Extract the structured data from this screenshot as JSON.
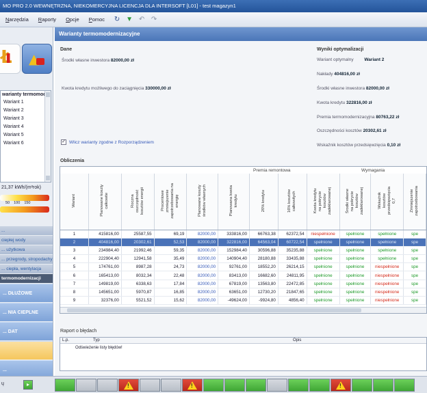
{
  "window": {
    "title": "MO PRO 2.0 WEWNĘTRZNA, NIEKOMERCYJNA LICENCJA DLA INTERSOFT [L01] - test magazyn1"
  },
  "menu": [
    {
      "label": "Narzędzia"
    },
    {
      "label": "Raporty"
    },
    {
      "label": "Opcje"
    },
    {
      "label": "Pomoc"
    }
  ],
  "panel": {
    "title": "Warianty termomodernizacyjne"
  },
  "sidebar": {
    "list_header": "warianty termomode",
    "list_items": [
      "Wariant 1",
      "Wariant 2",
      "Wariant 3",
      "Wariant 4",
      "Wariant 5",
      "Wariant 6"
    ],
    "rate": "21,37 kWh/(m²rok)",
    "scale_ticks": [
      "50",
      "100",
      "150"
    ],
    "small_items": [
      "... ",
      "ciepłej wody",
      "... użytkowa",
      "... przegrody, stropodachy",
      "... ciepła, wentylacja"
    ],
    "active_item": "termomodernizacji",
    "big_items": [
      "... DŁUŻOWE",
      "... NIA CIEPLNE",
      "... DAT",
      "",
      "... ",
      ""
    ]
  },
  "dane": {
    "label": "Dane",
    "own_funds_label": "Środki własne inwestora",
    "own_funds_value": "82000,00 zł",
    "credit_label": "Kwota kredytu możliwego do zaciągnięcia",
    "credit_value": "330000,00 zł",
    "checkbox_label": "Wlicz warianty zgodne z Rozporządzeniem"
  },
  "wyniki": {
    "label": "Wyniki optymalizacji",
    "optimal_label": "Wariant optymalny",
    "optimal_value": "Wariant 2",
    "expenses_label": "Nakłady",
    "expenses_value": "404816,00 zł",
    "own_label": "Środki własne inwestora",
    "own_value": "82000,00 zł",
    "credit_label": "Kwota kredytu",
    "credit_value": "322816,00 zł",
    "premium_label": "Premia termomodernizacyjna",
    "premium_value": "80763,22 zł",
    "savings_label": "Oszczędności kosztów",
    "savings_value": "20302,61 zł",
    "ratio_label": "Wskaźnik kosztów przedsięwzięcia",
    "ratio_value": "0,10 zł"
  },
  "obliczenia": {
    "label": "Obliczenia",
    "group_premia": "Premia remontowa",
    "group_wymagania": "Wymagania",
    "columns": [
      "Wariant",
      "Planowane koszty\ncałkowite",
      "Roczna\noszczędność\nkosztów energii",
      "Procentowe\nzmniejszenie\nzapotrzebowania na\nenergię",
      "Planowane koszty\nśrodków własnych",
      "Planowana kwota\nkredytu",
      "20% kredytu",
      "16% kosztów\ncałkowitych",
      "Kwota kredytu\nna pokrycie\nkosztów\nzadeklarowanej",
      "Środki własne\nna pokrycie\nkosztów\nzadeklarowanej",
      "Wskaźnik\nkosztów\nprzedsięwzięcia\n0,7",
      "Zmniejszenie\nzapotrzebowania"
    ],
    "rows": [
      [
        "1",
        "415816,00",
        "25587,55",
        "69,19",
        "82000,00",
        "333816,00",
        "66763,38",
        "62372,54",
        "niespełnione",
        "spełnione",
        "spełnione",
        "spe"
      ],
      [
        "2",
        "404816,00",
        "20302,61",
        "52,53",
        "82000,00",
        "322816,00",
        "64563,04",
        "60722,54",
        "spełnione",
        "spełnione",
        "spełnione",
        "spe"
      ],
      [
        "3",
        "234984,40",
        "21992,46",
        "59,35",
        "82000,00",
        "152984,40",
        "30596,88",
        "35235,88",
        "spełnione",
        "spełnione",
        "spełnione",
        "spe"
      ],
      [
        "4",
        "222904,40",
        "12941,58",
        "35,49",
        "82000,00",
        "140904,40",
        "28180,88",
        "33435,88",
        "spełnione",
        "spełnione",
        "spełnione",
        "spe"
      ],
      [
        "5",
        "174761,00",
        "8987,28",
        "24,73",
        "82000,00",
        "92761,00",
        "18552,20",
        "26214,15",
        "spełnione",
        "spełnione",
        "niespełnione",
        "spe"
      ],
      [
        "6",
        "165413,00",
        "8032,34",
        "22,48",
        "82000,00",
        "83413,00",
        "16682,60",
        "24811,95",
        "spełnione",
        "spełnione",
        "niespełnione",
        "spe"
      ],
      [
        "7",
        "149819,00",
        "6338,63",
        "17,84",
        "82000,00",
        "67819,00",
        "13563,80",
        "22472,85",
        "spełnione",
        "spełnione",
        "niespełnione",
        "spe"
      ],
      [
        "8",
        "145651,00",
        "5970,87",
        "16,85",
        "82000,00",
        "63651,00",
        "12730,20",
        "21847,65",
        "spełnione",
        "spełnione",
        "niespełnione",
        "spe"
      ],
      [
        "9",
        "32376,00",
        "5521,52",
        "15,62",
        "82000,00",
        "-49624,00",
        "-9924,80",
        "4856,40",
        "spełnione",
        "spełnione",
        "niespełnione",
        "spe"
      ]
    ]
  },
  "raport": {
    "label": "Raport o błędach",
    "col_lp": "L.p.",
    "col_typ": "Typ",
    "col_opis": "Opis",
    "message": "Odświeżenie listy błędów!"
  },
  "statusbar": {
    "tiles": [
      "g",
      "s",
      "s",
      "r",
      "s",
      "s",
      "r",
      "g",
      "g",
      "g",
      "s",
      "g",
      "g",
      "r",
      "g",
      "g",
      "g",
      "s",
      "s",
      "g",
      "g",
      "g",
      "g",
      "g",
      "s",
      "s",
      "g",
      "g"
    ]
  }
}
